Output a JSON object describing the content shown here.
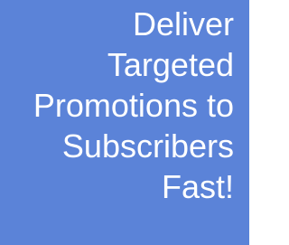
{
  "colors": {
    "background": "#5b83d8",
    "text": "#ffffff"
  },
  "headline": {
    "lines": [
      "Deliver",
      "Targeted",
      "Promotions to",
      "Subscribers",
      "Fast!"
    ]
  }
}
